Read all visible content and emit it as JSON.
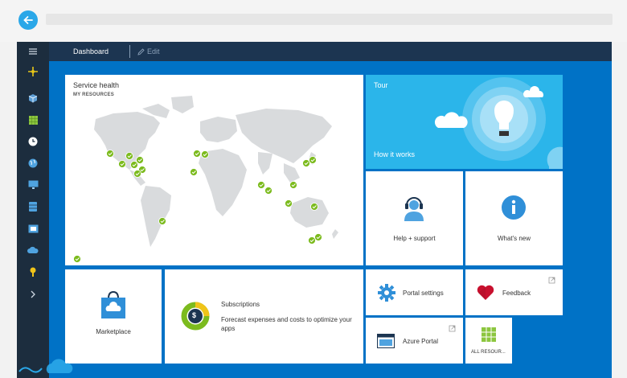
{
  "topbar": {
    "dashboard_label": "Dashboard",
    "edit_label": "Edit"
  },
  "nav": {
    "icons": [
      "menu-icon",
      "new-icon",
      "cube-icon",
      "grid-icon",
      "clock-icon",
      "globe-icon",
      "monitor-icon",
      "database-icon",
      "storage-icon",
      "cloud-service-icon",
      "key-icon",
      "chevron-right-icon"
    ]
  },
  "tiles": {
    "service_health": {
      "title": "Service health",
      "subtitle": "MY RESOURCES"
    },
    "tour": {
      "title": "Tour",
      "link": "How it works"
    },
    "help": {
      "label": "Help + support"
    },
    "whats_new": {
      "label": "What's new"
    },
    "marketplace": {
      "label": "Marketplace"
    },
    "subscriptions": {
      "title": "Subscriptions",
      "description": "Forecast expenses and costs to optimize your apps",
      "badge": "$"
    },
    "portal_settings": {
      "label": "Portal settings"
    },
    "feedback": {
      "label": "Feedback"
    },
    "azure_portal": {
      "label": "Azure Portal"
    },
    "all_resources": {
      "label": "ALL RESOUR..."
    }
  },
  "colors": {
    "portal_blue": "#0072c6",
    "nav_dark": "#1c2d3e",
    "tour_blue": "#2bb5ea",
    "status_green": "#7cbb1e"
  }
}
